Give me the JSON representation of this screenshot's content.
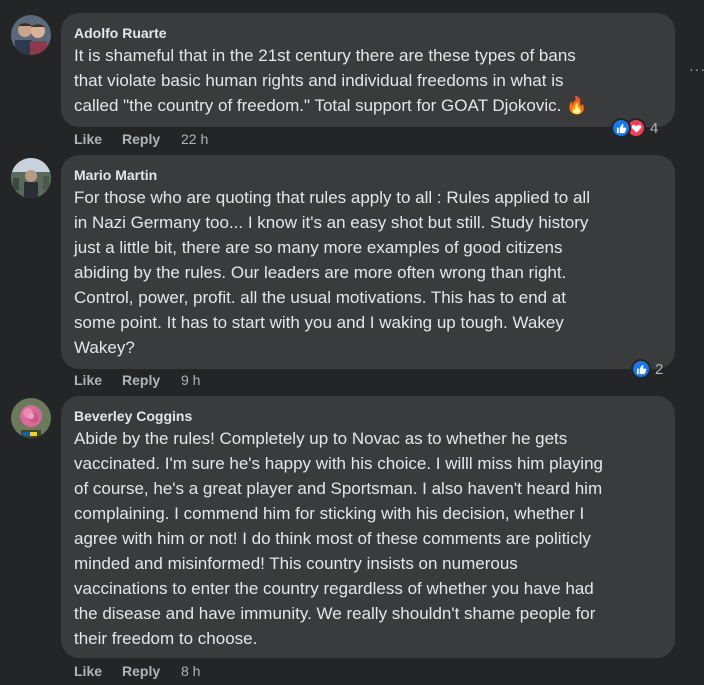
{
  "comments": [
    {
      "author": "Adolfo Ruarte",
      "text": "It is shameful that in the 21st century there are these types of bans\nthat violate basic human rights and individual freedoms in what is\ncalled \"the country of freedom.\" Total support for GOAT Djokovic.",
      "like_label": "Like",
      "reply_label": "Reply",
      "time": "22 h",
      "reaction_count": "4",
      "reactions": [
        "like-icon",
        "love-icon"
      ]
    },
    {
      "author": "Mario Martin",
      "text": "For those who are quoting that rules apply to all : Rules applied to all\nin Nazi Germany too... I know it's an easy shot but still. Study history\njust a little bit, there are so many more examples of good citizens\nabiding by the rules. Our leaders are more often wrong than right.\nControl, power, profit. all the usual motivations. This has to end at\nsome point. It has to start with you and I waking up tough. Wakey\nWakey?",
      "like_label": "Like",
      "reply_label": "Reply",
      "time": "9 h",
      "reaction_count": "2",
      "reactions": [
        "like-icon"
      ]
    },
    {
      "author": "Beverley Coggins",
      "text": "Abide by the rules! Completely up to Novac as to whether he gets\nvaccinated. I'm sure he's happy with his choice. I willl miss him playing\nof course, he's a great player and Sportsman. I also haven't heard him\ncomplaining. I commend him for sticking with his decision, whether I\nagree with him or not! I do think most of these comments are politicly\nminded and misinformed! This country insists on numerous\nvaccinations to enter the country regardless of whether you have had\nthe disease and have immunity. We really shouldn't shame people for\ntheir freedom to choose.",
      "like_label": "Like",
      "reply_label": "Reply",
      "time": "8 h"
    }
  ],
  "colors": {
    "background": "#242526",
    "bubble": "#3a3b3c",
    "text": "#e4e6eb",
    "muted": "#b0b3b8",
    "like_blue": "#1877f2",
    "love_red": "#f33e58"
  },
  "icons": {
    "fire_emoji": "🔥",
    "more_options": "⋮"
  }
}
